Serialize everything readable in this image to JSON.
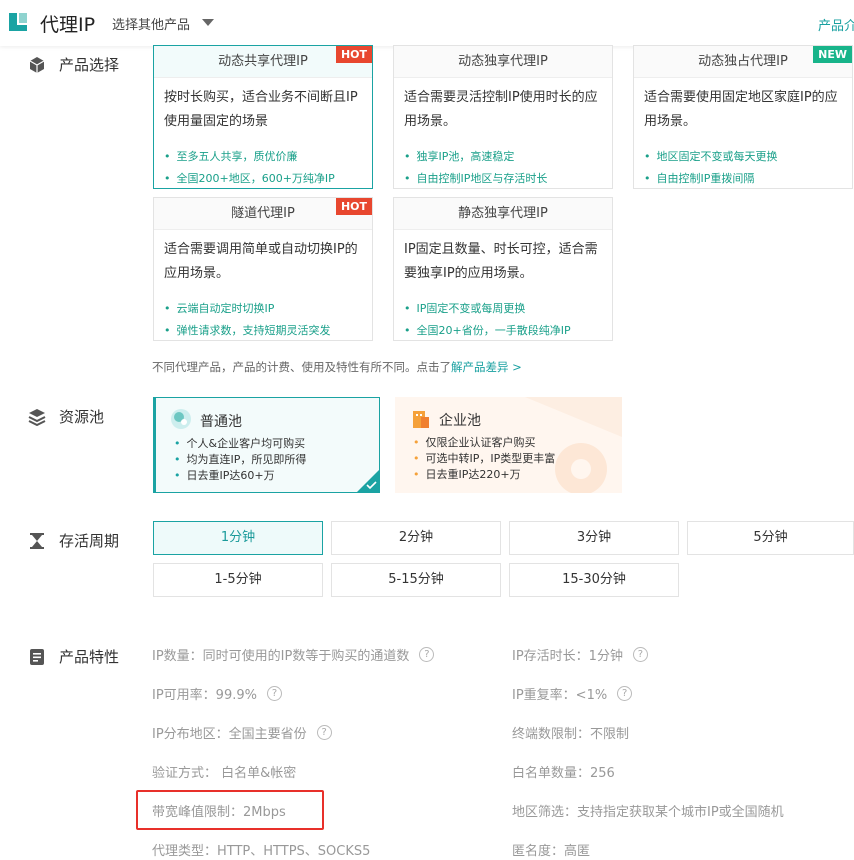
{
  "header": {
    "brand": "代理IP",
    "select_other": "选择其他产品",
    "right_link": "产品介"
  },
  "sections": {
    "product_select": "产品选择",
    "resource_pool": "资源池",
    "survival": "存活周期",
    "features": "产品特性"
  },
  "products": [
    {
      "title": "动态共享代理IP",
      "tag": "HOT",
      "desc": "按时长购买，适合业务不间断且IP使用量固定的场景",
      "bullets": [
        "至多五人共享，质优价廉",
        "全国200+地区，600+万纯净IP"
      ]
    },
    {
      "title": "动态独享代理IP",
      "tag": "",
      "desc": "适合需要灵活控制IP使用时长的应用场景。",
      "bullets": [
        "独享IP池，高速稳定",
        "自由控制IP地区与存活时长"
      ]
    },
    {
      "title": "动态独占代理IP",
      "tag": "NEW",
      "desc": "适合需要使用固定地区家庭IP的应用场景。",
      "bullets": [
        "地区固定不变或每天更换",
        "自由控制IP重拨间隔"
      ]
    },
    {
      "title": "隧道代理IP",
      "tag": "HOT",
      "desc": "适合需要调用简单或自动切换IP的应用场景。",
      "bullets": [
        "云端自动定时切换IP",
        "弹性请求数，支持短期灵活突发"
      ]
    },
    {
      "title": "静态独享代理IP",
      "tag": "",
      "desc": "IP固定且数量、时长可控，适合需要独享IP的应用场景。",
      "bullets": [
        "IP固定不变或每周更换",
        "全国20+省份，一手散段纯净IP"
      ]
    }
  ],
  "note": {
    "text": "不同代理产品，产品的计费、使用及特性有所不同。点击了",
    "link": "解产品差异 >"
  },
  "pools": [
    {
      "title": "普通池",
      "bullets": [
        "个人&企业客户均可购买",
        "均为直连IP，所见即所得",
        "日去重IP达60+万"
      ]
    },
    {
      "title": "企业池",
      "bullets": [
        "仅限企业认证客户购买",
        "可选中转IP，IP类型更丰富",
        "日去重IP达220+万"
      ]
    }
  ],
  "durations": [
    "1分钟",
    "2分钟",
    "3分钟",
    "5分钟",
    "1-5分钟",
    "5-15分钟",
    "15-30分钟"
  ],
  "features": [
    {
      "text": "IP数量：同时可使用的IP数等于购买的通道数",
      "help": true
    },
    {
      "text": "IP存活时长：1分钟",
      "help": true
    },
    {
      "text": "IP可用率：99.9%",
      "help": true
    },
    {
      "text": "IP重复率：<1%",
      "help": true
    },
    {
      "text": "IP分布地区：全国主要省份",
      "help": true
    },
    {
      "text": "终端数限制：不限制",
      "help": false
    },
    {
      "text": "验证方式： 白名单&帐密",
      "help": false
    },
    {
      "text": "白名单数量：256",
      "help": false
    },
    {
      "text": "带宽峰值限制：2Mbps",
      "help": false
    },
    {
      "text": "地区筛选：支持指定获取某个城市IP或全国随机",
      "help": false
    },
    {
      "text": "代理类型：HTTP、HTTPS、SOCKS5",
      "help": false
    },
    {
      "text": "匿名度：高匿",
      "help": false
    }
  ],
  "help_glyph": "?",
  "colors": {
    "accent": "#1aa3a3",
    "hot": "#e8472f",
    "new": "#18b48a",
    "highlight_box": "#e8302a"
  }
}
